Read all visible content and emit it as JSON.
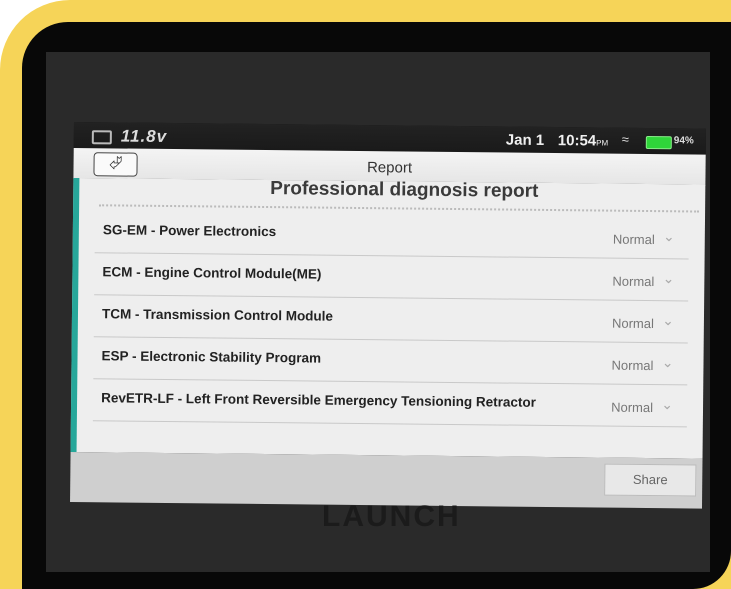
{
  "statusbar": {
    "voltage": "11.8v",
    "date": "Jan 1",
    "time": "10:54",
    "ampm": "PM",
    "battery_pct": "94%"
  },
  "topbar": {
    "back_icon": "back-arrow-icon",
    "title": "Report"
  },
  "report": {
    "heading": "Professional diagnosis report",
    "rows": [
      {
        "label": "SG-EM - Power Electronics",
        "status": "Normal"
      },
      {
        "label": "ECM - Engine Control Module(ME)",
        "status": "Normal"
      },
      {
        "label": "TCM - Transmission Control Module",
        "status": "Normal"
      },
      {
        "label": "ESP - Electronic Stability Program",
        "status": "Normal"
      },
      {
        "label": "RevETR-LF - Left Front Reversible Emergency Tensioning Retractor",
        "status": "Normal"
      }
    ]
  },
  "actions": {
    "share_label": "Share"
  },
  "brand": "LAUNCH",
  "colors": {
    "frame": "#f6d458",
    "accent": "#27a79a",
    "battery": "#2fd53a"
  }
}
